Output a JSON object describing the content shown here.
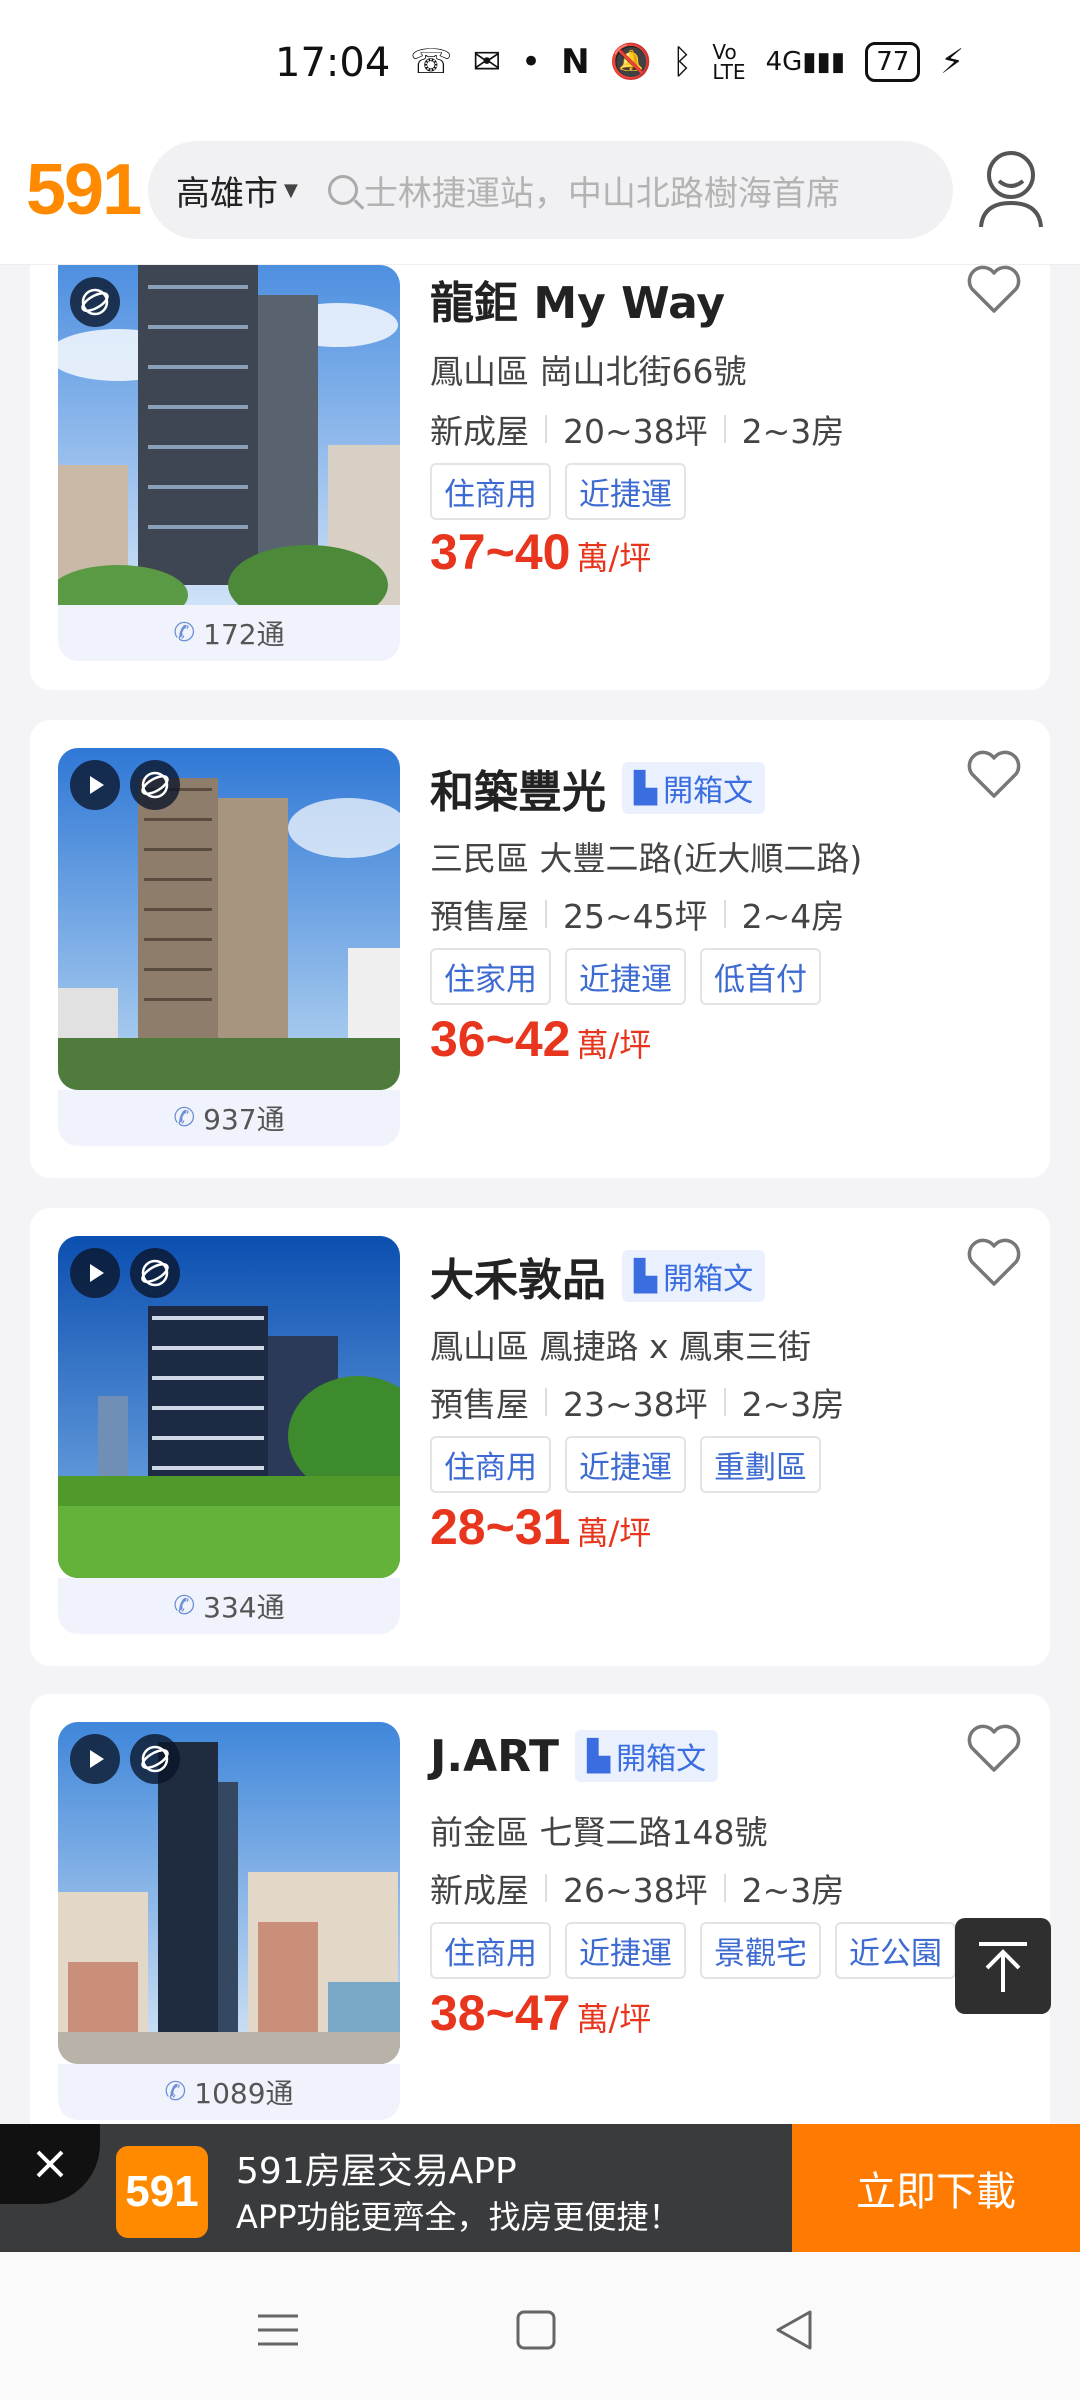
{
  "status_bar": {
    "time": "17:04",
    "battery": "77",
    "icons": [
      "missed-call-icon",
      "messenger-icon",
      "dot-icon",
      "nfc-icon",
      "mute-icon",
      "bluetooth-icon",
      "volte-icon",
      "signal-4g-icon",
      "battery-icon",
      "charging-icon"
    ]
  },
  "header": {
    "logo": "591",
    "city": "高雄市",
    "search_placeholder": "士林捷運站，中山北路樹海首席"
  },
  "listings": [
    {
      "title": "龍鉅 My Way",
      "has_article": false,
      "has_video": false,
      "address": "鳳山區 崗山北街66號",
      "type": "新成屋",
      "area": "20~38坪",
      "rooms": "2~3房",
      "tags": [
        "住商用",
        "近捷運"
      ],
      "price": "37~40",
      "price_unit": "萬/坪",
      "calls": "172通"
    },
    {
      "title": "和築豐光",
      "has_article": true,
      "article_label": "開箱文",
      "has_video": true,
      "address": "三民區 大豐二路(近大順二路)",
      "type": "預售屋",
      "area": "25~45坪",
      "rooms": "2~4房",
      "tags": [
        "住家用",
        "近捷運",
        "低首付"
      ],
      "price": "36~42",
      "price_unit": "萬/坪",
      "calls": "937通"
    },
    {
      "title": "大禾敦品",
      "has_article": true,
      "article_label": "開箱文",
      "has_video": true,
      "address": "鳳山區 鳳捷路 x 鳳東三街",
      "type": "預售屋",
      "area": "23~38坪",
      "rooms": "2~3房",
      "tags": [
        "住商用",
        "近捷運",
        "重劃區"
      ],
      "price": "28~31",
      "price_unit": "萬/坪",
      "calls": "334通"
    },
    {
      "title": "J.ART",
      "has_article": true,
      "article_label": "開箱文",
      "has_video": true,
      "address": "前金區 七賢二路148號",
      "type": "新成屋",
      "area": "26~38坪",
      "rooms": "2~3房",
      "tags": [
        "住商用",
        "近捷運",
        "景觀宅",
        "近公園"
      ],
      "price": "38~47",
      "price_unit": "萬/坪",
      "calls": "1089通"
    }
  ],
  "banner": {
    "logo": "591",
    "title": "591房屋交易APP",
    "subtitle": "APP功能更齊全，找房更便捷！",
    "button": "立即下載"
  },
  "navbar": [
    "menu-icon",
    "home-icon",
    "back-icon"
  ]
}
